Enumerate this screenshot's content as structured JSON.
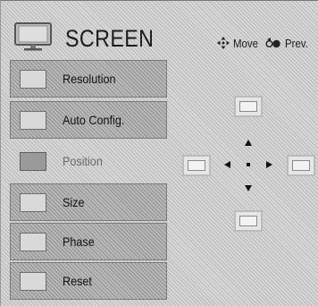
{
  "header": {
    "title": "SCREEN",
    "hints": {
      "move_label": "Move",
      "move_icon": "dpad-icon",
      "prev_label": "Prev.",
      "prev_icon": "return-icon"
    }
  },
  "menu": {
    "items": [
      {
        "label": "Resolution",
        "icon": "resolution-icon",
        "selected": false
      },
      {
        "label": "Auto Config.",
        "icon": "auto-config-icon",
        "selected": false
      },
      {
        "label": "Position",
        "icon": "position-icon",
        "selected": true
      },
      {
        "label": "Size",
        "icon": "size-icon",
        "selected": false
      },
      {
        "label": "Phase",
        "icon": "phase-icon",
        "selected": false
      },
      {
        "label": "Reset",
        "icon": "reset-icon",
        "selected": false
      }
    ]
  },
  "position_control": {
    "directions": [
      "up",
      "down",
      "left",
      "right"
    ]
  },
  "colors": {
    "text": "#111111",
    "disabled_text": "#6b6b6b",
    "item_border": "#7a7a7a"
  }
}
